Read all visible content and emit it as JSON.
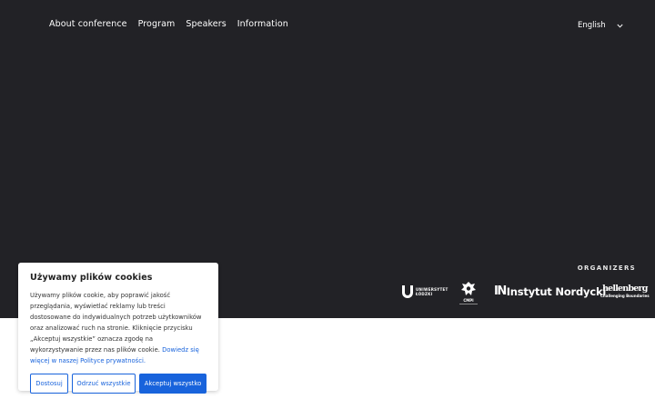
{
  "nav": {
    "items": [
      "About conference",
      "Program",
      "Speakers",
      "Information"
    ]
  },
  "language": {
    "selected": "English",
    "icon": "chevron-down-icon"
  },
  "footer": {
    "organizers_label": "ORGANIZERS",
    "logos": {
      "ul": {
        "line1": "UNIWERSYTET",
        "line2": "ŁÓDZKI"
      },
      "cmpi": {
        "text": "CMPI"
      },
      "instytut": {
        "mark": "IN",
        "text": "Instytut Nordycki"
      },
      "hellenberg": {
        "line1": "hellenberg",
        "line2": "Challenging Boundaries"
      }
    }
  },
  "cookie": {
    "title": "Używamy plików cookies",
    "body": "Używamy plików cookie, aby poprawić jakość przeglądania, wyświetlać reklamy lub treści dostosowane do indywidualnych potrzeb użytkowników oraz analizować ruch na stronie. Kliknięcie przycisku „Akceptuj wszystkie” oznacza zgodę na wykorzystywanie przez nas plików cookie.",
    "link": "Dowiedz się więcej w naszej Polityce prywatności.",
    "buttons": {
      "customize": "Dostosuj",
      "reject": "Odrzuć wszystkie",
      "accept": "Akceptuj wszystko"
    }
  },
  "colors": {
    "hero_bg": "#222226",
    "accent": "#1863dc"
  }
}
